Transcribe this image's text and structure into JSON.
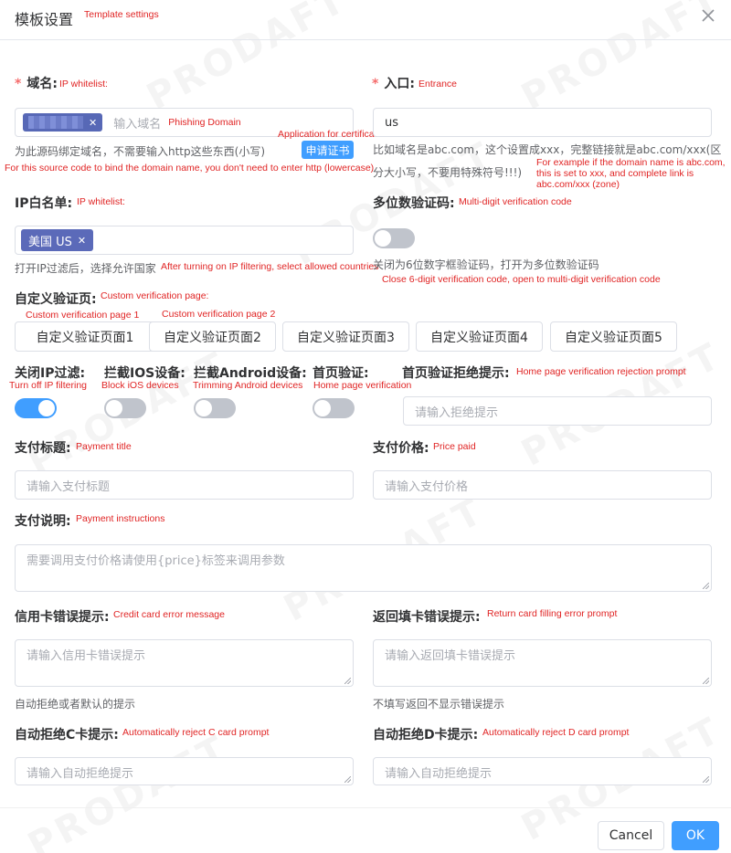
{
  "dialog": {
    "title": "模板设置",
    "title_note": "Template settings",
    "close_icon": "close-icon"
  },
  "domain": {
    "label": "域名:",
    "note": "IP whitelist:",
    "tag_value": "",
    "placeholder": "输入域名",
    "placeholder_note": "Phishing Domain",
    "apply_note": "Application for certificate",
    "apply_button": "申请证书",
    "hint": "为此源码绑定域名，不需要输入http这些东西(小写)",
    "hint_note": "For this source code to bind the domain name, you don't need to enter http (lowercase)"
  },
  "entrance": {
    "label": "入口:",
    "note": "Entrance",
    "value": "us",
    "hint_line1": "比如域名是abc.com，这个设置成xxx，完整链接就是abc.com/xxx(区",
    "hint_line2": "分大小写，不要用特殊符号!!!)",
    "hint_note_1": "For example if the domain name is abc.com,",
    "hint_note_2": "this is set to xxx, and complete link is",
    "hint_note_3": "abc.com/xxx (zone)"
  },
  "ip_whitelist": {
    "label": "IP白名单:",
    "note": "IP whitelist:",
    "tag": "美国 US",
    "hint": "打开IP过滤后，选择允许国家",
    "hint_note": "After turning on IP filtering, select allowed countries"
  },
  "multi_code": {
    "label": "多位数验证码:",
    "note": "Multi-digit verification code",
    "hint": "关闭为6位数字框验证码，打开为多位数验证码",
    "hint_note": "Close 6-digit verification code, open to multi-digit verification code",
    "enabled": false
  },
  "custom_page": {
    "label": "自定义验证页:",
    "note": "Custom verification page:",
    "note_1": "Custom verification page 1",
    "note_2": "Custom verification page 2",
    "buttons": [
      "自定义验证页面1",
      "自定义验证页面2",
      "自定义验证页面3",
      "自定义验证页面4",
      "自定义验证页面5"
    ]
  },
  "toggles": {
    "ip_filter": {
      "label": "关闭IP过滤:",
      "note": "Turn off IP filtering",
      "enabled": true
    },
    "block_ios": {
      "label": "拦截IOS设备:",
      "note": "Block iOS devices",
      "enabled": false
    },
    "block_android": {
      "label": "拦截Android设备:",
      "note": "Trimming Android devices",
      "enabled": false
    },
    "home_verify": {
      "label": "首页验证:",
      "note": "Home page verification",
      "enabled": false
    }
  },
  "reject_prompt": {
    "label": "首页验证拒绝提示:",
    "note": "Home page verification rejection prompt",
    "placeholder": "请输入拒绝提示"
  },
  "pay_title": {
    "label": "支付标题:",
    "note": "Payment title",
    "placeholder": "请输入支付标题"
  },
  "pay_price": {
    "label": "支付价格:",
    "note": "Price paid",
    "placeholder": "请输入支付价格"
  },
  "pay_desc": {
    "label": "支付说明:",
    "note": "Payment instructions",
    "placeholder": "需要调用支付价格请使用{price}标签来调用参数"
  },
  "card_error": {
    "label": "信用卡错误提示:",
    "note": "Credit card error message",
    "placeholder": "请输入信用卡错误提示",
    "hint": "自动拒绝或者默认的提示"
  },
  "return_error": {
    "label": "返回填卡错误提示:",
    "note": "Return card filling error prompt",
    "placeholder": "请输入返回填卡错误提示",
    "hint": "不填写返回不显示错误提示"
  },
  "reject_c": {
    "label": "自动拒绝C卡提示:",
    "note": "Automatically reject C card prompt",
    "placeholder": "请输入自动拒绝提示"
  },
  "reject_d": {
    "label": "自动拒绝D卡提示:",
    "note": "Automatically reject D card prompt",
    "placeholder": "请输入自动拒绝提示"
  },
  "footer": {
    "cancel": "Cancel",
    "ok": "OK"
  },
  "watermark": "PRODAFT",
  "colors": {
    "primary": "#409eff",
    "tag": "#5768b6",
    "annotation": "#e02424",
    "required": "#f56c6c"
  }
}
